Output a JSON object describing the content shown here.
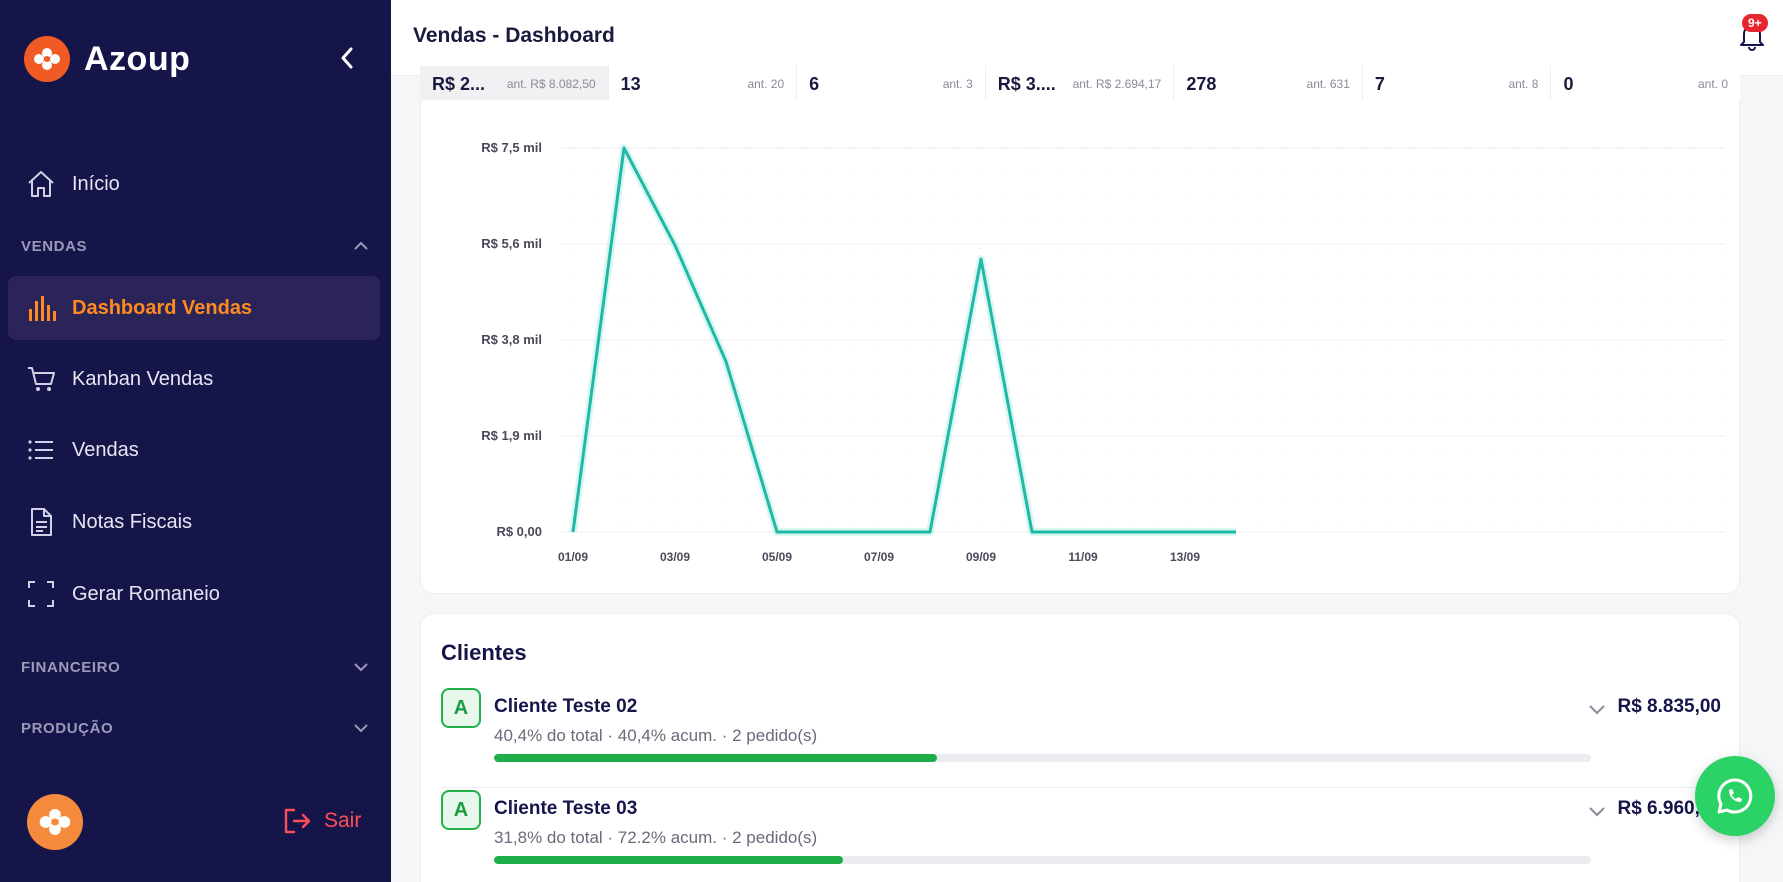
{
  "sidebar": {
    "brand": "Azoup",
    "inicio": "Início",
    "sections": {
      "vendas": "VENDAS",
      "financeiro": "FINANCEIRO",
      "producao": "PRODUÇÃO"
    },
    "items": [
      {
        "label": "Dashboard Vendas",
        "icon": "bar-chart-icon",
        "active": true
      },
      {
        "label": "Kanban Vendas",
        "icon": "cart-icon"
      },
      {
        "label": "Vendas",
        "icon": "list-icon"
      },
      {
        "label": "Notas Fiscais",
        "icon": "document-icon"
      },
      {
        "label": "Gerar Romaneio",
        "icon": "scan-frame-icon"
      }
    ],
    "logout": "Sair"
  },
  "header": {
    "title": "Vendas - Dashboard",
    "notification_badge": "9+"
  },
  "kpis": [
    {
      "value": "R$ 2...",
      "prev": "ant. R$ 8.082,50"
    },
    {
      "value": "13",
      "prev": "ant. 20"
    },
    {
      "value": "6",
      "prev": "ant. 3"
    },
    {
      "value": "R$ 3....",
      "prev": "ant. R$ 2.694,17"
    },
    {
      "value": "278",
      "prev": "ant. 631"
    },
    {
      "value": "7",
      "prev": "ant. 8"
    },
    {
      "value": "0",
      "prev": "ant. 0"
    }
  ],
  "chart_data": {
    "type": "line",
    "x": [
      "01/09",
      "02/09",
      "03/09",
      "04/09",
      "05/09",
      "06/09",
      "07/09",
      "08/09",
      "09/09",
      "10/09",
      "11/09",
      "12/09",
      "13/09",
      "14/09"
    ],
    "x_tick_labels": [
      "01/09",
      "03/09",
      "05/09",
      "07/09",
      "09/09",
      "11/09",
      "13/09"
    ],
    "values": [
      0,
      7500,
      5600,
      3330,
      0,
      0,
      0,
      0,
      5330,
      0,
      0,
      0,
      0,
      0
    ],
    "y_ticks": [
      0,
      1875,
      3750,
      5625,
      7500
    ],
    "y_tick_labels": [
      "R$ 0,00",
      "R$ 1,9 mil",
      "R$ 3,8 mil",
      "R$ 5,6 mil",
      "R$ 7,5 mil"
    ],
    "ylim": [
      0,
      7500
    ],
    "grid": true,
    "colors": {
      "line": "#1fb9a6"
    }
  },
  "clients": {
    "title": "Clientes",
    "rows": [
      {
        "grade": "A",
        "name": "Cliente Teste 02",
        "meta": "40,4% do total · 40,4% acum. · 2 pedido(s)",
        "share": 0.404,
        "value": "R$ 8.835,00"
      },
      {
        "grade": "A",
        "name": "Cliente Teste 03",
        "meta": "31,8% do total · 72.2% acum. · 2 pedido(s)",
        "share": 0.318,
        "value": "R$ 6.960,00"
      }
    ]
  },
  "colors": {
    "sidebar_bg": "#16154a",
    "accent_orange": "#ff8a1f",
    "logout_red": "#ff4d57",
    "bar_green": "#1eae47",
    "whatsapp_green": "#2bd366"
  }
}
